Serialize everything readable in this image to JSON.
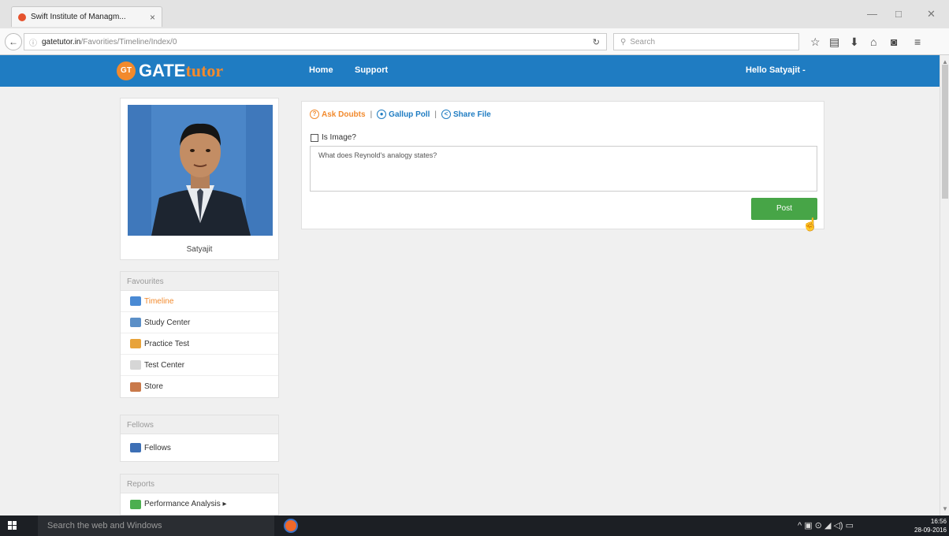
{
  "browser": {
    "tab_title": "Swift Institute of Managm...",
    "tab_close": "×",
    "url_host": "gatetutor.in",
    "url_path": "/Favorities/Timeline/Index/0",
    "search_placeholder": "Search",
    "icons": [
      "star-icon",
      "reader-icon",
      "download-icon",
      "home-icon",
      "pocket-icon",
      "menu-icon"
    ]
  },
  "site": {
    "logo_badge": "GT",
    "logo_gate": "GATE",
    "logo_tutor": "tutor",
    "nav": [
      "Home",
      "Support"
    ],
    "greeting": "Hello Satyajit -"
  },
  "profile": {
    "name": "Satyajit"
  },
  "favourites": {
    "heading": "Favourites",
    "items": [
      "Timeline",
      "Study Center",
      "Practice Test",
      "Test Center",
      "Store"
    ]
  },
  "fellows": {
    "heading": "Fellows",
    "items": [
      "Fellows"
    ]
  },
  "reports": {
    "heading": "Reports",
    "items": [
      "Performance Analysis ▸"
    ]
  },
  "post": {
    "tabs": [
      "Ask Doubts",
      "Gallup Poll",
      "Share File"
    ],
    "separator": "|",
    "is_image_label": "Is Image?",
    "text": "What does Reynold's analogy states?",
    "button": "Post"
  },
  "taskbar": {
    "search_placeholder": "Search the web and Windows",
    "time": "16:56",
    "date": "28-09-2016"
  },
  "colors": {
    "header_blue": "#1f7cc2",
    "accent_orange": "#f28a2d",
    "post_green": "#47a547"
  }
}
